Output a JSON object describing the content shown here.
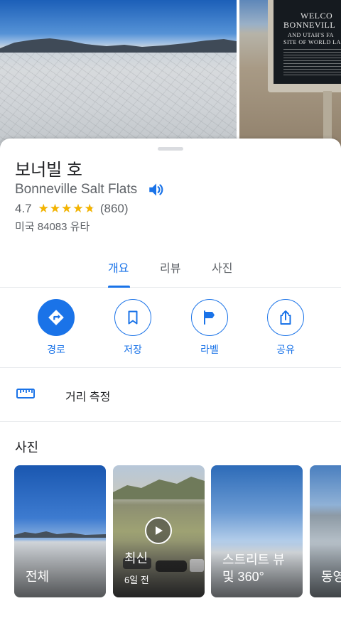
{
  "hero": {
    "sign": {
      "line1": "WELCO",
      "line2": "BONNEVILL",
      "line3": "AND UTAH'S FA",
      "line4": "SITE OF WORLD LA"
    }
  },
  "place": {
    "name_ko": "보너빌 호",
    "name_en": "Bonneville Salt Flats",
    "rating": "4.7",
    "rating_value": 4.7,
    "review_count": "(860)",
    "address": "미국 84083 유타"
  },
  "tabs": [
    {
      "label": "개요",
      "active": true
    },
    {
      "label": "리뷰",
      "active": false
    },
    {
      "label": "사진",
      "active": false
    }
  ],
  "actions": {
    "directions": "경로",
    "save": "저장",
    "label": "라벨",
    "share": "공유"
  },
  "measure": {
    "label": "거리 측정"
  },
  "photos": {
    "heading": "사진",
    "items": [
      {
        "caption": "전체",
        "sub": ""
      },
      {
        "caption": "최신",
        "sub": "6일 전"
      },
      {
        "caption": "스트리트 뷰\n및 360°",
        "line1": "스트리트 뷰",
        "line2": "및 360°"
      },
      {
        "caption": "동영"
      }
    ]
  },
  "colors": {
    "accent": "#1a73e8",
    "star": "#f4b400",
    "text_secondary": "#5f6368"
  }
}
